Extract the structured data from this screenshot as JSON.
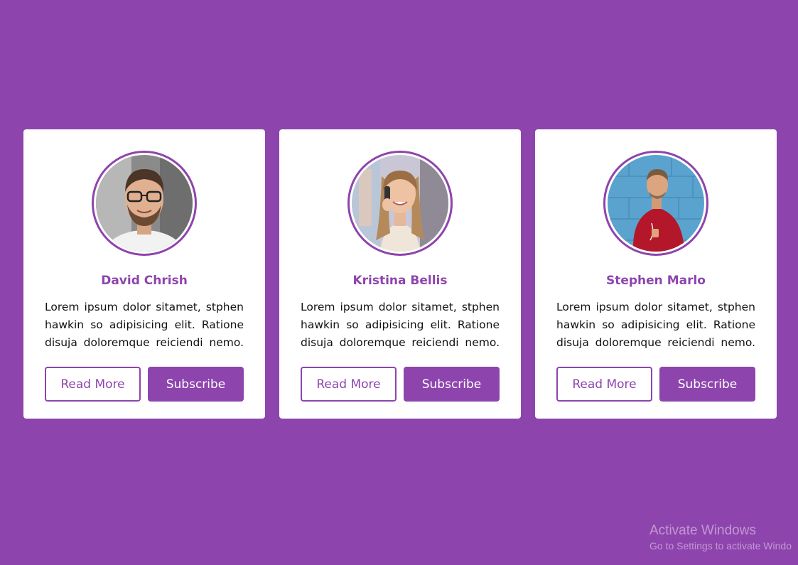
{
  "colors": {
    "background": "#8e44ad",
    "card": "#ffffff",
    "accent": "#8e44ad",
    "text": "#111111"
  },
  "cards": [
    {
      "name": "David Chrish",
      "avatar": "portrait-man-glasses",
      "description": "Lorem ipsum dolor sitamet, stphen hawkin so adipisicing elit. Ratione disuja doloremque reiciendi nemo.",
      "read_more_label": "Read More",
      "subscribe_label": "Subscribe"
    },
    {
      "name": "Kristina Bellis",
      "avatar": "portrait-woman-phone",
      "description": "Lorem ipsum dolor sitamet, stphen hawkin so adipisicing elit. Ratione disuja doloremque reiciendi nemo.",
      "read_more_label": "Read More",
      "subscribe_label": "Subscribe"
    },
    {
      "name": "Stephen Marlo",
      "avatar": "portrait-man-red-sweater",
      "description": "Lorem ipsum dolor sitamet, stphen hawkin so adipisicing elit. Ratione disuja doloremque reiciendi nemo.",
      "read_more_label": "Read More",
      "subscribe_label": "Subscribe"
    }
  ],
  "watermark": {
    "title": "Activate Windows",
    "subtitle": "Go to Settings to activate Windo"
  }
}
